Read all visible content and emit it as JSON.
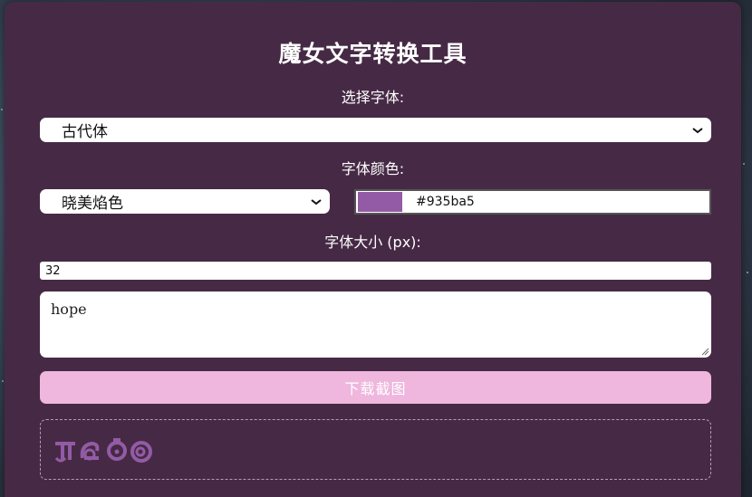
{
  "app": {
    "title": "魔女文字转换工具"
  },
  "font_select": {
    "label": "选择字体:",
    "selected": "古代体"
  },
  "color": {
    "label": "字体颜色:",
    "preset_selected": "晓美焰色",
    "hex_value": "#935ba5",
    "swatch_color": "#935ba5"
  },
  "size": {
    "label": "字体大小 (px):",
    "value": "32"
  },
  "text_input": {
    "value": "hope"
  },
  "download": {
    "label": "下载截图"
  },
  "preview": {
    "text": "hope",
    "color": "#935ba5"
  },
  "icons": {
    "dropdown": "chevron-down-icon",
    "resize": "resize-grip-icon"
  },
  "colors": {
    "panel_bg": "#462a45",
    "button_bg": "#efb6de"
  }
}
